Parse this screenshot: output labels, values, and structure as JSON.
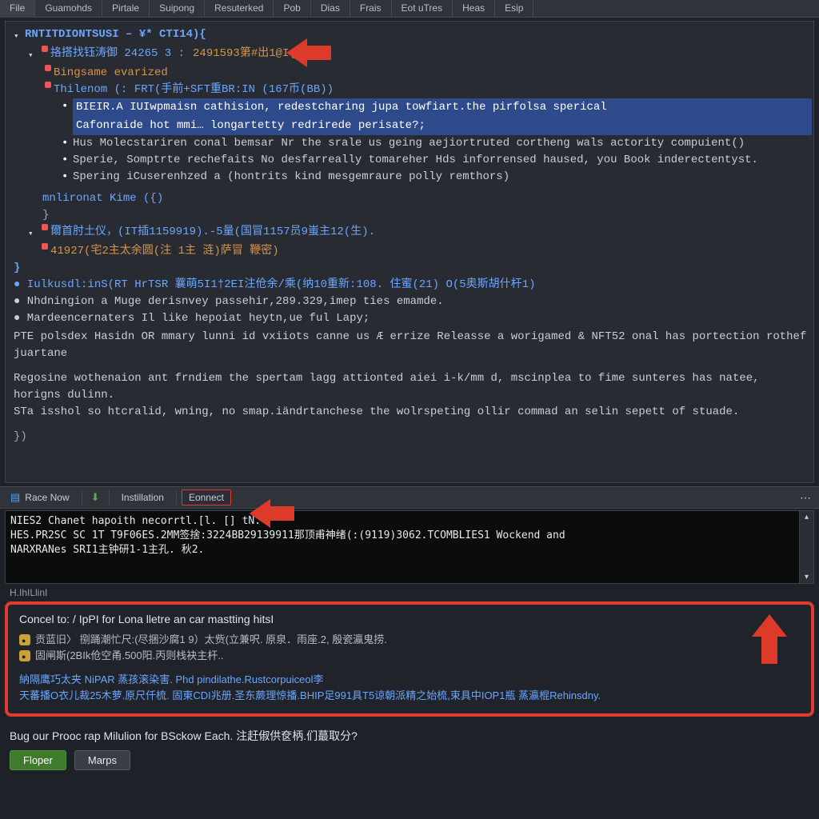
{
  "menubar": [
    "File",
    "Guamohds",
    "Pirtale",
    "Suipong",
    "Resuterked",
    "Pob",
    "Dias",
    "Frais",
    "Eot uTres",
    "Heas",
    "Esip"
  ],
  "editor": {
    "root": "RNTITDIONTSUSI – ¥*  CTI14){",
    "line_id": "挌搭找钰涛御 24265 3 :",
    "line_id_code": "2491593第#出1@I(I)",
    "warn": "Bingsame evarized",
    "file_line": "Thilenom (: FRT(手前+SFT重BR:IN (167币(BB))",
    "sel_a": "BIEIR.A IUIwpmaisn cathision, redestcharing jupa towfiart.the pirfolsa sperical",
    "sel_b": "Cafonraide hot mmi… longartetty redrirede perisate?;",
    "b1": "Hus Molecstariren conal bemsar   Nr the srale us geing aejiortruted cortheng wals actority compuient()",
    "b2": "Sperie, Somptrte rechefaits No desfarreally tomareher Hds inforrensed haused, you Book inderectentyst.",
    "b3": "Spering iCuserenhzed a (hontrits kind mesgemraure polly remthors)",
    "nl_fn": "mnlironat Kime ({)",
    "brace": "}",
    "stat_a": "爾首肘土仪，(IT插1159919).-5量(国冒1157员9蚩主12(生).",
    "stat_b": "41927(宅2主太余圆(注  1主 涟)萨冒 鞭密)",
    "end_brace": "}",
    "log1": "● Iulkusdl:inS(RT HrTSR  蘘萌5I1†2EI注伧余/乘(纳10重新:108. 住蜜(21)  O(5奥斯胡什杆1)",
    "log2": "● Nhdningion a Muge derisnvey passehir,289.329,imep ties emamde.",
    "log3": "● Mardeencernaters Il like hepoiat heytn,ue ful Lapy;",
    "par1": "PTE polsdex Hasidn OR mmary lunni id vxiiots canne us Æ errize Releasse a  worigamed & NFT52 onal has portection rothef juartane",
    "par2": "Regosine wothenaion ant frndiem the spertam lagg attionted aiei i-k/mm d, mscinplea to fime sunteres has natee, horigns dulinn.",
    "par3": "STa isshol so htcralid, wning, no smap.iändrtanchese the wolrspeting ollir commad an selin sepett of stuade.",
    "coda": "})"
  },
  "mid_toolbar": {
    "race": "Race Now",
    "install": "Instillation",
    "connect": "Eonnect"
  },
  "console": {
    "l1": "NIES2 Chanet hapoith necorrtl.[l.  [] tN.",
    "l2": "HES.PR2SC SC 1T T9F06ES.2MM签捨:3224BB29139911那顶甫神绪(:(9119)3062.TCOMBLIES1 Wockend and",
    "l3": "NARXRANes SRI1主钟研1-1主孔. 秋2."
  },
  "tag_strip": "H.IhILlinI",
  "bottom_box": {
    "title": "Concel to: / IpPI for Lona lletre an car mastting hitsI",
    "info1": "贡蓝旧〉 捌踊潮忙尺:(尽捆沙腐1 9）太赀(立兼呎. 原泉．雨座.2, 殷瓷瀛鬼捞.",
    "info2": "固闸斯(2BIk伧空甬.500阳.丙则栈袂主杆..",
    "link_line": "納隔鹰巧太夹  NiPAR  蒸孩滚染害. Phd pindilathe.Rustcorpuiceol李",
    "link_tail": "天蕃播О衣儿裁25木萝.原尺仟梳. 固東CDI兆册.圣东蕨理惊播.BHIP足991具T5谅朝派精之始梳,束具中IOP1瓶  蒸瀛棍Rehinsdny."
  },
  "footer": {
    "prompt": "Bug our Prooc rap Milulion for BSckow Each. 注赶俶供奁柄.们蕞取分?",
    "primary": "Floper",
    "secondary": "Marps"
  },
  "colors": {
    "accent_red": "#e03b2f",
    "link_blue": "#6aa6ff",
    "warn_orange": "#d6944b",
    "bg": "#1e2228"
  }
}
